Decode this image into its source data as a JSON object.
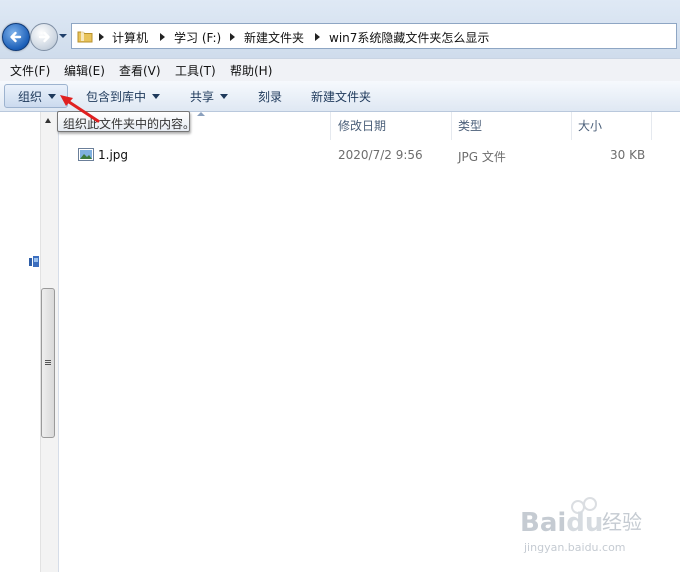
{
  "address_bar": {
    "breadcrumbs": [
      "计算机",
      "学习 (F:)",
      "新建文件夹",
      "win7系统隐藏文件夹怎么显示"
    ]
  },
  "menu": {
    "items": [
      "文件(F)",
      "编辑(E)",
      "查看(V)",
      "工具(T)",
      "帮助(H)"
    ]
  },
  "toolbar": {
    "organize": "组织",
    "include_in_library": "包含到库中",
    "share": "共享",
    "burn": "刻录",
    "new_folder": "新建文件夹"
  },
  "tooltip": {
    "text": "组织此文件夹中的内容。"
  },
  "columns": {
    "date_modified": "修改日期",
    "type": "类型",
    "size": "大小"
  },
  "files": [
    {
      "name": "1.jpg",
      "date": "2020/7/2 9:56",
      "type": "JPG 文件",
      "size": "30 KB"
    }
  ],
  "watermark": {
    "brand": "Baidu经验",
    "url": "jingyan.baidu.com"
  },
  "colors": {
    "accent_arrow": "#e02020",
    "toolbar_text": "#1e395b"
  }
}
